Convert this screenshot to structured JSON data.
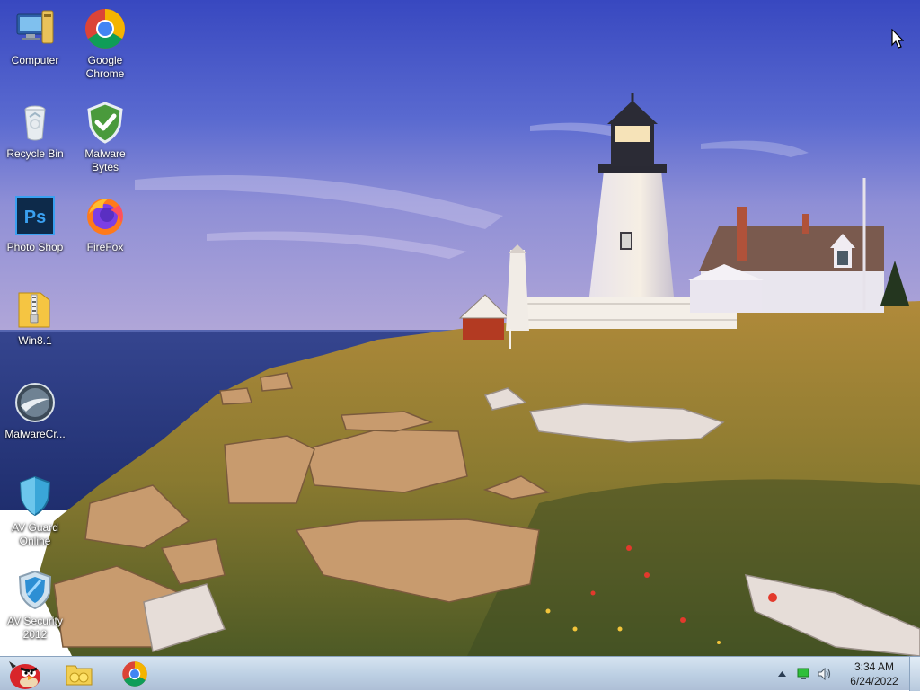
{
  "desktop": {
    "icons": [
      {
        "label": "Computer",
        "icon": "computer-icon"
      },
      {
        "label": "Google Chrome",
        "icon": "chrome-icon"
      },
      {
        "label": "Recycle Bin",
        "icon": "recycle-bin-icon"
      },
      {
        "label": "Malware Bytes",
        "icon": "shield-check-icon"
      },
      {
        "label": "Photo Shop",
        "icon": "photoshop-icon"
      },
      {
        "label": "FireFox",
        "icon": "firefox-icon"
      },
      {
        "label": "Win8.1",
        "icon": "zip-folder-icon"
      },
      {
        "label": "MalwareCr...",
        "icon": "malwarecrusher-icon"
      },
      {
        "label": "AV Guard Online",
        "icon": "shield-icon"
      },
      {
        "label": "AV Security 2012",
        "icon": "av-security-icon"
      }
    ]
  },
  "taskbar": {
    "pinned": [
      {
        "icon": "angry-bird-start-icon"
      },
      {
        "icon": "folder-icon"
      },
      {
        "icon": "chrome-icon"
      }
    ],
    "tray": {
      "icons": [
        "chevron-up-icon",
        "network-icon",
        "speaker-icon"
      ],
      "time": "3:34 AM",
      "date": "6/24/2022"
    }
  },
  "colors": {
    "sky_top": "#3b4fc4",
    "sea": "#2a3f8f",
    "grass": "#a67a32",
    "taskbar": "#c3d4e7"
  }
}
